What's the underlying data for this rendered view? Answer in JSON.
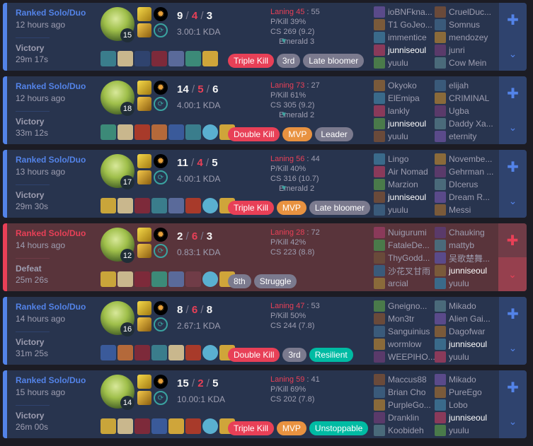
{
  "matches": [
    {
      "result": "win",
      "queue": "Ranked Solo/Duo",
      "ago": "12 hours ago",
      "outcome": "Victory",
      "duration": "29m 17s",
      "level": "15",
      "kills": "9",
      "deaths": "4",
      "assists": "3",
      "kda_ratio": "3.00:1 KDA",
      "laning": "Laning 45",
      "laning_opp": ": 55",
      "pkill": "P/Kill 39%",
      "cs": "CS 269 (9.2)",
      "rank": "Emerald 3",
      "badges": [
        {
          "label": "Triple Kill",
          "color": "red"
        },
        {
          "label": "3rd",
          "color": "gray"
        },
        {
          "label": "Late bloomer",
          "color": "gray"
        }
      ],
      "items": [
        "#3a7d8c",
        "#c9b78d",
        "#2f436e",
        "#7d2a3a",
        "#5a6a9a",
        "#3c8a78",
        "#cfa53a"
      ],
      "team1": [
        "ioBNFkna...",
        "T1 GoJeo...",
        "immentice",
        "junniseoul",
        "yuulu"
      ],
      "team2": [
        "CruelDuc...",
        "Somnus",
        "mendozey",
        "junri",
        "Cow Mein"
      ]
    },
    {
      "result": "win",
      "queue": "Ranked Solo/Duo",
      "ago": "12 hours ago",
      "outcome": "Victory",
      "duration": "33m 12s",
      "level": "18",
      "kills": "14",
      "deaths": "5",
      "assists": "6",
      "kda_ratio": "4.00:1 KDA",
      "laning": "Laning 73",
      "laning_opp": ": 27",
      "pkill": "P/Kill 61%",
      "cs": "CS 305 (9.2)",
      "rank": "Emerald 2",
      "badges": [
        {
          "label": "Double Kill",
          "color": "red"
        },
        {
          "label": "MVP",
          "color": "orange"
        },
        {
          "label": "Leader",
          "color": "gray"
        }
      ],
      "items": [
        "#3c8a78",
        "#c9b78d",
        "#a83a2a",
        "#b4693a",
        "#3a5a9a",
        "#3a7d8c",
        "#5ab0d0",
        "#cfa53a"
      ],
      "team1": [
        "Okyoko",
        "ElEmipa",
        "lankly",
        "junniseoul",
        "yuulu"
      ],
      "team2": [
        "elijah",
        "CRIMINAL",
        "Ugba",
        "Daddy Xa...",
        "eternity"
      ]
    },
    {
      "result": "win",
      "queue": "Ranked Solo/Duo",
      "ago": "13 hours ago",
      "outcome": "Victory",
      "duration": "29m 30s",
      "level": "17",
      "kills": "11",
      "deaths": "4",
      "assists": "5",
      "kda_ratio": "4.00:1 KDA",
      "laning": "Laning 56",
      "laning_opp": ": 44",
      "pkill": "P/Kill 40%",
      "cs": "CS 316 (10.7)",
      "rank": "Emerald 2",
      "badges": [
        {
          "label": "Triple Kill",
          "color": "red"
        },
        {
          "label": "MVP",
          "color": "orange"
        },
        {
          "label": "Late bloomer",
          "color": "gray"
        }
      ],
      "items": [
        "#c9a53a",
        "#c9b78d",
        "#7d2a3a",
        "#3a7d8c",
        "#5a6a9a",
        "#a83a2a",
        "#5ab0d0",
        "#cfa53a"
      ],
      "team1": [
        "Lingo",
        "Air Nomad",
        "Marzion",
        "junniseoul",
        "yuulu"
      ],
      "team2": [
        "Novembe...",
        "Gehrman ...",
        "DIcerus",
        "Dream R...",
        "Messi"
      ]
    },
    {
      "result": "loss",
      "queue": "Ranked Solo/Duo",
      "ago": "14 hours ago",
      "outcome": "Defeat",
      "duration": "25m 26s",
      "level": "12",
      "kills": "2",
      "deaths": "6",
      "assists": "3",
      "kda_ratio": "0.83:1 KDA",
      "laning": "Laning 28",
      "laning_opp": ": 72",
      "pkill": "P/Kill 42%",
      "cs": "CS 223 (8.8)",
      "rank": "",
      "badges": [
        {
          "label": "8th",
          "color": "gray"
        },
        {
          "label": "Struggle",
          "color": "gray"
        }
      ],
      "items": [
        "#c9a53a",
        "#c9b78d",
        "#7d2a3a",
        "#3c8a78",
        "#5a6a9a",
        "empty",
        "#5ab0d0",
        "#cfa53a"
      ],
      "team1": [
        "Nuigurumi",
        "FataleDe...",
        "ThyGodd...",
        "沙花叉甘雨",
        "arcial"
      ],
      "team2": [
        "Chauking",
        "mattyb",
        "吴歌楚舞...",
        "junniseoul",
        "yuulu"
      ]
    },
    {
      "result": "win",
      "queue": "Ranked Solo/Duo",
      "ago": "14 hours ago",
      "outcome": "Victory",
      "duration": "31m 25s",
      "level": "16",
      "kills": "8",
      "deaths": "6",
      "assists": "8",
      "kda_ratio": "2.67:1 KDA",
      "laning": "Laning 47",
      "laning_opp": ": 53",
      "pkill": "P/Kill 50%",
      "cs": "CS 244 (7.8)",
      "rank": "",
      "badges": [
        {
          "label": "Double Kill",
          "color": "red"
        },
        {
          "label": "3rd",
          "color": "gray"
        },
        {
          "label": "Resilient",
          "color": "green"
        }
      ],
      "items": [
        "#3a5a9a",
        "#b4693a",
        "#7d2a3a",
        "#3a7d8c",
        "#c9b78d",
        "#a83a2a",
        "#5ab0d0",
        "#cfa53a"
      ],
      "team1": [
        "Gneigno...",
        "Mon3tr",
        "Sanguinius",
        "wormlow",
        "WEEPIHO..."
      ],
      "team2": [
        "Mikado",
        "Alien Gai...",
        "Dagofwar",
        "junniseoul",
        "yuulu"
      ]
    },
    {
      "result": "win",
      "queue": "Ranked Solo/Duo",
      "ago": "15 hours ago",
      "outcome": "Victory",
      "duration": "26m 00s",
      "level": "14",
      "kills": "15",
      "deaths": "2",
      "assists": "5",
      "kda_ratio": "10.00:1 KDA",
      "laning": "Laning 59",
      "laning_opp": ": 41",
      "pkill": "P/Kill 69%",
      "cs": "CS 202 (7.8)",
      "rank": "",
      "badges": [
        {
          "label": "Triple Kill",
          "color": "red"
        },
        {
          "label": "MVP",
          "color": "orange"
        },
        {
          "label": "Unstoppable",
          "color": "green"
        }
      ],
      "items": [
        "#c9a53a",
        "#c9b78d",
        "#7d2a3a",
        "#3a5a9a",
        "#cfa53a",
        "#a83a2a",
        "#5ab0d0",
        "#cfa53a"
      ],
      "team1": [
        "Maccus88",
        "Brian Cho",
        "PurpleGo...",
        "Dranklin",
        "Koobideh"
      ],
      "team2": [
        "Mikado",
        "PureEgo",
        "Lobo",
        "junniseoul",
        "yuulu"
      ]
    }
  ],
  "player_name": "junniseoul",
  "icons": {
    "spell": "flash-icon",
    "rune": "rune-icon",
    "share": "share-icon",
    "expand": "chevron-down-icon"
  }
}
